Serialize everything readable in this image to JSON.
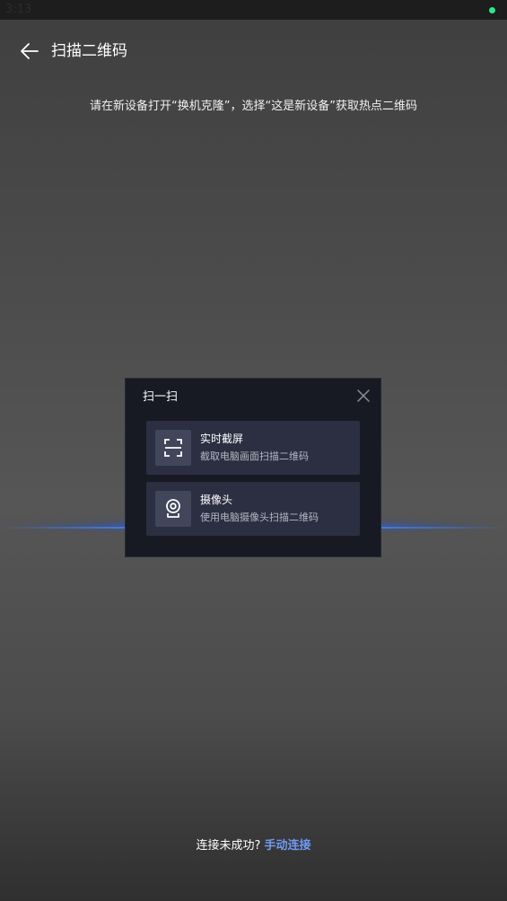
{
  "status_bar": {
    "time": "3:13",
    "dot_color": "#2ee88a"
  },
  "header": {
    "back_icon": "arrow-left-icon",
    "title": "扫描二维码"
  },
  "instruction": "请在新设备打开“换机克隆”，选择“这是新设备”获取热点二维码",
  "scan_dialog": {
    "title": "扫一扫",
    "close_icon": "close-icon",
    "options": [
      {
        "icon": "scan-frame-icon",
        "title": "实时截屏",
        "description": "截取电脑画面扫描二维码"
      },
      {
        "icon": "webcam-icon",
        "title": "摄像头",
        "description": "使用电脑摄像头扫描二维码"
      }
    ]
  },
  "footer": {
    "prefix": "连接未成功?",
    "link": "手动连接",
    "link_color": "#6f9bf2"
  },
  "colors": {
    "dialog_bg": "#181a23",
    "option_bg": "#2c2f41",
    "scan_line": "#4a7df0"
  }
}
